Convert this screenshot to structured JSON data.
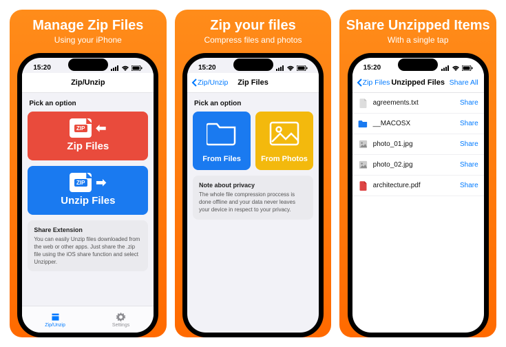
{
  "accent": "#007aff",
  "panels": [
    {
      "headline": "Manage Zip Files",
      "subhead": "Using your iPhone"
    },
    {
      "headline": "Zip your files",
      "subhead": "Compress files and photos"
    },
    {
      "headline": "Share Unzipped Items",
      "subhead": "With a single tap"
    }
  ],
  "status": {
    "time": "15:20"
  },
  "screen1": {
    "nav_title": "Zip/Unzip",
    "section": "Pick an option",
    "zip_card": "Zip Files",
    "unzip_card": "Unzip Files",
    "info_title": "Share Extension",
    "info_body": "You can easily Unzip files downloaded from the web or other apps. Just share the .zip file using the iOS share function and select Unzipper.",
    "tabs": {
      "zip": "Zip/Unzip",
      "settings": "Settings"
    }
  },
  "screen2": {
    "back": "Zip/Unzip",
    "nav_title": "Zip Files",
    "section": "Pick an option",
    "from_files": "From Files",
    "from_photos": "From Photos",
    "info_title": "Note about privacy",
    "info_body": "The whole file compression proccess is done offline and your data never leaves your device in respect to your privacy."
  },
  "screen3": {
    "back": "Zip Files",
    "nav_title": "Unzipped Files",
    "share_all": "Share All",
    "share": "Share",
    "files": [
      {
        "name": "agreements.txt",
        "type": "txt"
      },
      {
        "name": "__MACOSX",
        "type": "folder"
      },
      {
        "name": "photo_01.jpg",
        "type": "img"
      },
      {
        "name": "photo_02.jpg",
        "type": "img"
      },
      {
        "name": "architecture.pdf",
        "type": "pdf"
      }
    ]
  }
}
